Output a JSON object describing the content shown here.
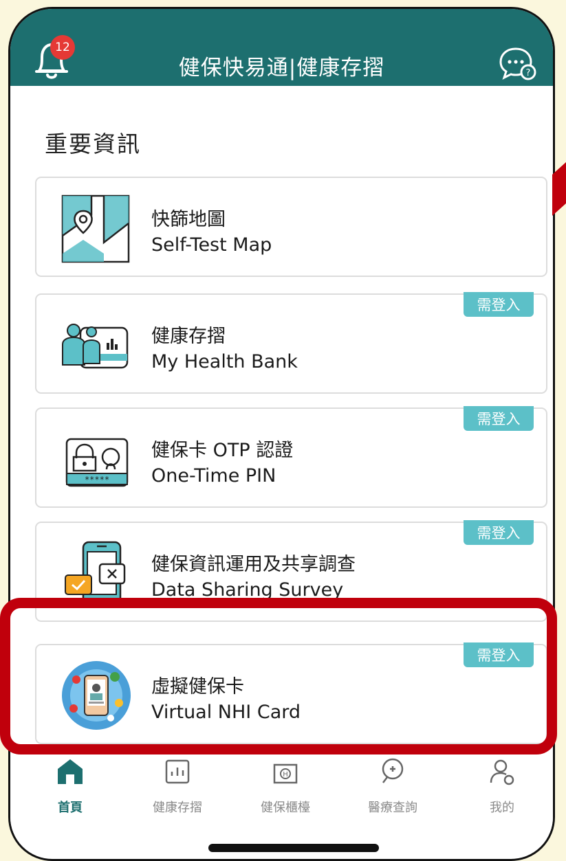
{
  "header": {
    "title": "健保快易通|健康存摺",
    "notification_count": "12",
    "left_icon": "bell-icon",
    "right_icon": "chat-help-icon",
    "bg_color": "#1d6f6f"
  },
  "section_title": "重要資訊",
  "cards": [
    {
      "zh": "快篩地圖",
      "en": "Self-Test Map",
      "icon": "map-pin-icon",
      "tag": ""
    },
    {
      "zh": "健康存摺",
      "en": "My Health Bank",
      "icon": "health-bank-icon",
      "tag": "需登入"
    },
    {
      "zh": "健保卡 OTP 認證",
      "en": "One-Time PIN",
      "icon": "lock-id-icon",
      "tag": "需登入"
    },
    {
      "zh": "健保資訊運用及共享調查",
      "en": "Data Sharing Survey",
      "icon": "phone-survey-icon",
      "tag": "需登入"
    },
    {
      "zh": "虛擬健保卡",
      "en": "Virtual NHI Card",
      "icon": "virtual-card-icon",
      "tag": "需登入"
    }
  ],
  "tabs": [
    {
      "label": "首頁",
      "icon": "home-icon",
      "active": true
    },
    {
      "label": "健康存摺",
      "icon": "health-bank-tab-icon",
      "active": false
    },
    {
      "label": "健保櫃檯",
      "icon": "counter-icon",
      "active": false
    },
    {
      "label": "醫療查詢",
      "icon": "medical-search-icon",
      "active": false
    },
    {
      "label": "我的",
      "icon": "profile-settings-icon",
      "active": false
    }
  ],
  "colors": {
    "accent": "#1d6f6f",
    "tag": "#5cc0c8",
    "highlight": "#c0000c",
    "badge": "#e53935"
  }
}
